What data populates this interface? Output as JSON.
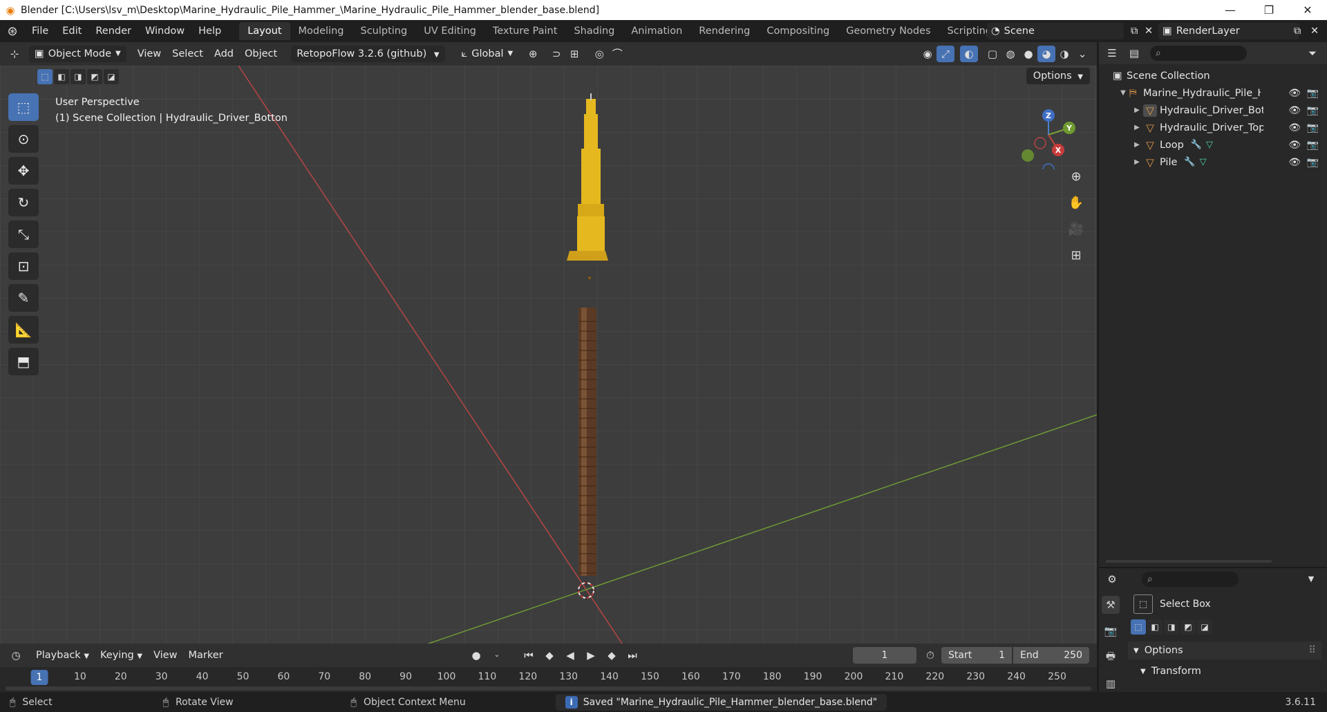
{
  "window": {
    "title": "Blender [C:\\Users\\lsv_m\\Desktop\\Marine_Hydraulic_Pile_Hammer_\\Marine_Hydraulic_Pile_Hammer_blender_base.blend]",
    "minimize": "—",
    "maximize": "❐",
    "close": "✕"
  },
  "menus": [
    "File",
    "Edit",
    "Render",
    "Window",
    "Help"
  ],
  "workspaces": [
    "Layout",
    "Modeling",
    "Sculpting",
    "UV Editing",
    "Texture Paint",
    "Shading",
    "Animation",
    "Rendering",
    "Compositing",
    "Geometry Nodes",
    "Scripting"
  ],
  "active_workspace": "Layout",
  "scene": {
    "name": "Scene",
    "render_layer": "RenderLayer"
  },
  "viewport_header": {
    "mode": "Object Mode",
    "menus": [
      "View",
      "Select",
      "Add",
      "Object"
    ],
    "addon": "RetopoFlow 3.2.6 (github)",
    "orientation": "Global",
    "options": "Options"
  },
  "viewport": {
    "perspective": "User Perspective",
    "context": "(1) Scene Collection | Hydraulic_Driver_Botton",
    "gizmo_labels": {
      "z": "Z",
      "y": "Y",
      "x": "X"
    }
  },
  "tools": [
    "select-box",
    "cursor",
    "move",
    "rotate",
    "scale",
    "transform",
    "annotate",
    "measure",
    "add-cube"
  ],
  "outliner": {
    "root": "Scene Collection",
    "collection": "Marine_Hydraulic_Pile_Hai",
    "objects": [
      "Hydraulic_Driver_Bott",
      "Hydraulic_Driver_Top",
      "Loop",
      "Pile"
    ]
  },
  "properties": {
    "tool_name": "Select Box",
    "options_label": "Options",
    "transform_label": "Transform"
  },
  "timeline": {
    "menus": [
      "Playback",
      "Keying",
      "View",
      "Marker"
    ],
    "current_frame": "1",
    "start_label": "Start",
    "start": "1",
    "end_label": "End",
    "end": "250",
    "ticks": [
      "1",
      "10",
      "20",
      "30",
      "40",
      "50",
      "60",
      "70",
      "80",
      "90",
      "100",
      "110",
      "120",
      "130",
      "140",
      "150",
      "160",
      "170",
      "180",
      "190",
      "200",
      "210",
      "220",
      "230",
      "240",
      "250"
    ]
  },
  "status": {
    "select": "Select",
    "rotate": "Rotate View",
    "context_menu": "Object Context Menu",
    "message": "Saved \"Marine_Hydraulic_Pile_Hammer_blender_base.blend\"",
    "version": "3.6.11"
  },
  "colors": {
    "accent": "#4772b3",
    "hammer": "#e5b81f",
    "pile": "#5a3a24",
    "x_axis": "#c8423f",
    "y_axis": "#7aa23a"
  }
}
